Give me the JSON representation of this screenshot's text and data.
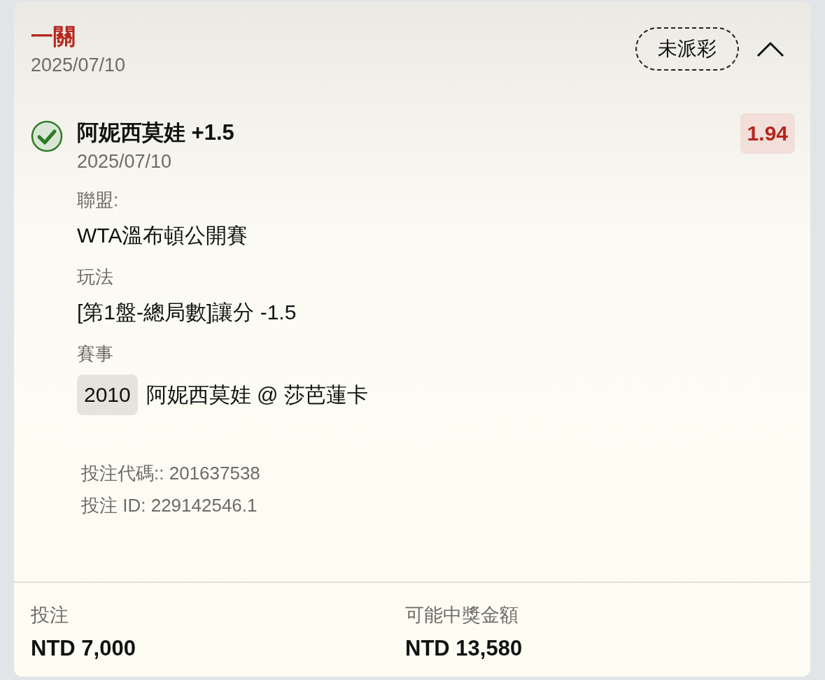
{
  "bet_type": "一關",
  "date": "2025/07/10",
  "status": "未派彩",
  "expanded": true,
  "selection": {
    "name": "阿妮西莫娃 +1.5",
    "date": "2025/07/10",
    "odds": "1.94",
    "fields": [
      {
        "label": "聯盟:",
        "value": "WTA溫布頓公開賽"
      },
      {
        "label": "玩法",
        "value": "[第1盤-總局數]讓分 -1.5"
      },
      {
        "label": "賽事",
        "event_code": "2010",
        "value": "阿妮西莫娃 @ 莎芭蓮卡"
      }
    ]
  },
  "references": [
    "投注代碼:: 201637538",
    "投注 ID: 229142546.1"
  ],
  "summary": [
    {
      "label": "投注",
      "value": "NTD 7,000"
    },
    {
      "label": "可能中獎金額",
      "value": "NTD 13,580"
    }
  ]
}
